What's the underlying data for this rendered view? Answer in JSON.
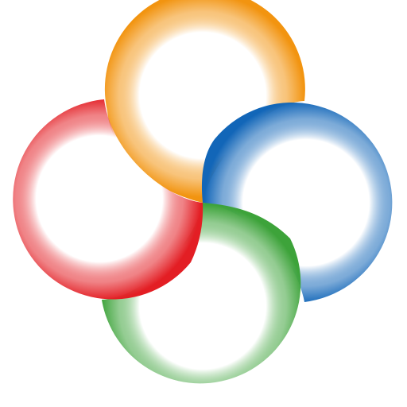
{
  "logo": {
    "icon_name": "four-color-swirl-logo-icon",
    "petals": [
      {
        "name": "orange",
        "color": "#F29410"
      },
      {
        "name": "blue",
        "color": "#1266B8"
      },
      {
        "name": "green",
        "color": "#3DA33A"
      },
      {
        "name": "red",
        "color": "#E31E24"
      }
    ]
  }
}
